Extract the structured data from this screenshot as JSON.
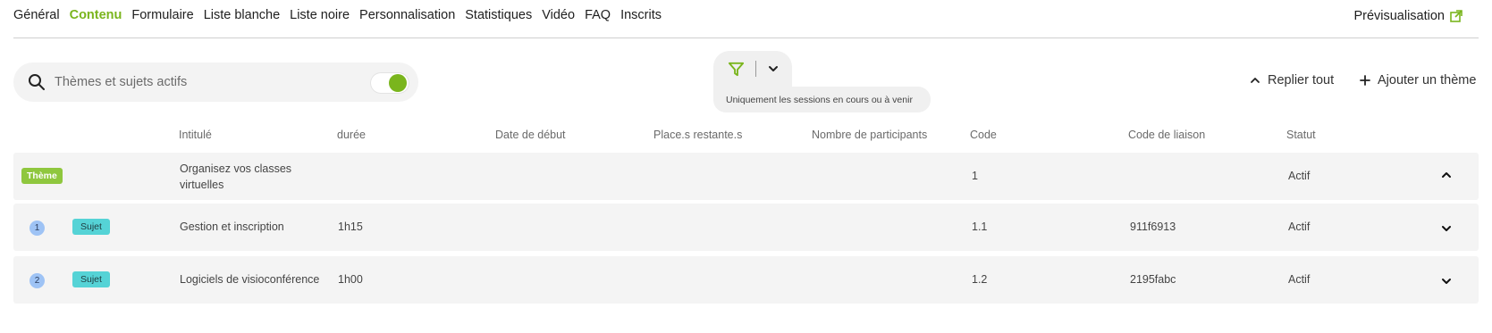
{
  "nav": {
    "tabs": [
      {
        "label": "Général",
        "active": false
      },
      {
        "label": "Contenu",
        "active": true
      },
      {
        "label": "Formulaire",
        "active": false
      },
      {
        "label": "Liste blanche",
        "active": false
      },
      {
        "label": "Liste noire",
        "active": false
      },
      {
        "label": "Personnalisation",
        "active": false
      },
      {
        "label": "Statistiques",
        "active": false
      },
      {
        "label": "Vidéo",
        "active": false
      },
      {
        "label": "FAQ",
        "active": false
      },
      {
        "label": "Inscrits",
        "active": false
      }
    ],
    "preview_label": "Prévisualisation"
  },
  "search": {
    "placeholder": "Thèmes et sujets actifs",
    "value": "",
    "toggle_on": true
  },
  "filter": {
    "note": "Uniquement les sessions en cours ou à venir"
  },
  "actions": {
    "collapse_all": "Replier tout",
    "add_theme": "Ajouter un thème"
  },
  "table": {
    "headers": {
      "title": "Intitulé",
      "duration": "durée",
      "start_date": "Date de début",
      "seats_left": "Place.s restante.s",
      "participants": "Nombre de participants",
      "code": "Code",
      "link_code": "Code de liaison",
      "status": "Statut"
    },
    "rows": [
      {
        "type": "Thème",
        "number": "",
        "title": "Organisez vos classes virtuelles",
        "duration": "",
        "start_date": "",
        "seats_left": "",
        "participants": "",
        "code": "1",
        "link_code": "",
        "status": "Actif",
        "expanded": true
      },
      {
        "type": "Sujet",
        "number": "1",
        "title": "Gestion et inscription",
        "duration": "1h15",
        "start_date": "",
        "seats_left": "",
        "participants": "",
        "code": "1.1",
        "link_code": "911f6913",
        "status": "Actif",
        "expanded": false
      },
      {
        "type": "Sujet",
        "number": "2",
        "title": "Logiciels de visioconférence",
        "duration": "1h00",
        "start_date": "",
        "seats_left": "",
        "participants": "",
        "code": "1.2",
        "link_code": "2195fabc",
        "status": "Actif",
        "expanded": false
      }
    ]
  },
  "colors": {
    "accent": "#7ab51d",
    "theme_badge": "#8fc73e",
    "subject_badge": "#55d3d6",
    "number_circle": "#9ec3f5",
    "row_bg": "#f4f4f4"
  },
  "icons": {
    "preview": "external-link-icon",
    "search": "search-icon",
    "filter": "funnel-icon",
    "dropdown": "chevron-down-icon",
    "collapse": "chevron-up-icon",
    "add": "plus-icon"
  }
}
